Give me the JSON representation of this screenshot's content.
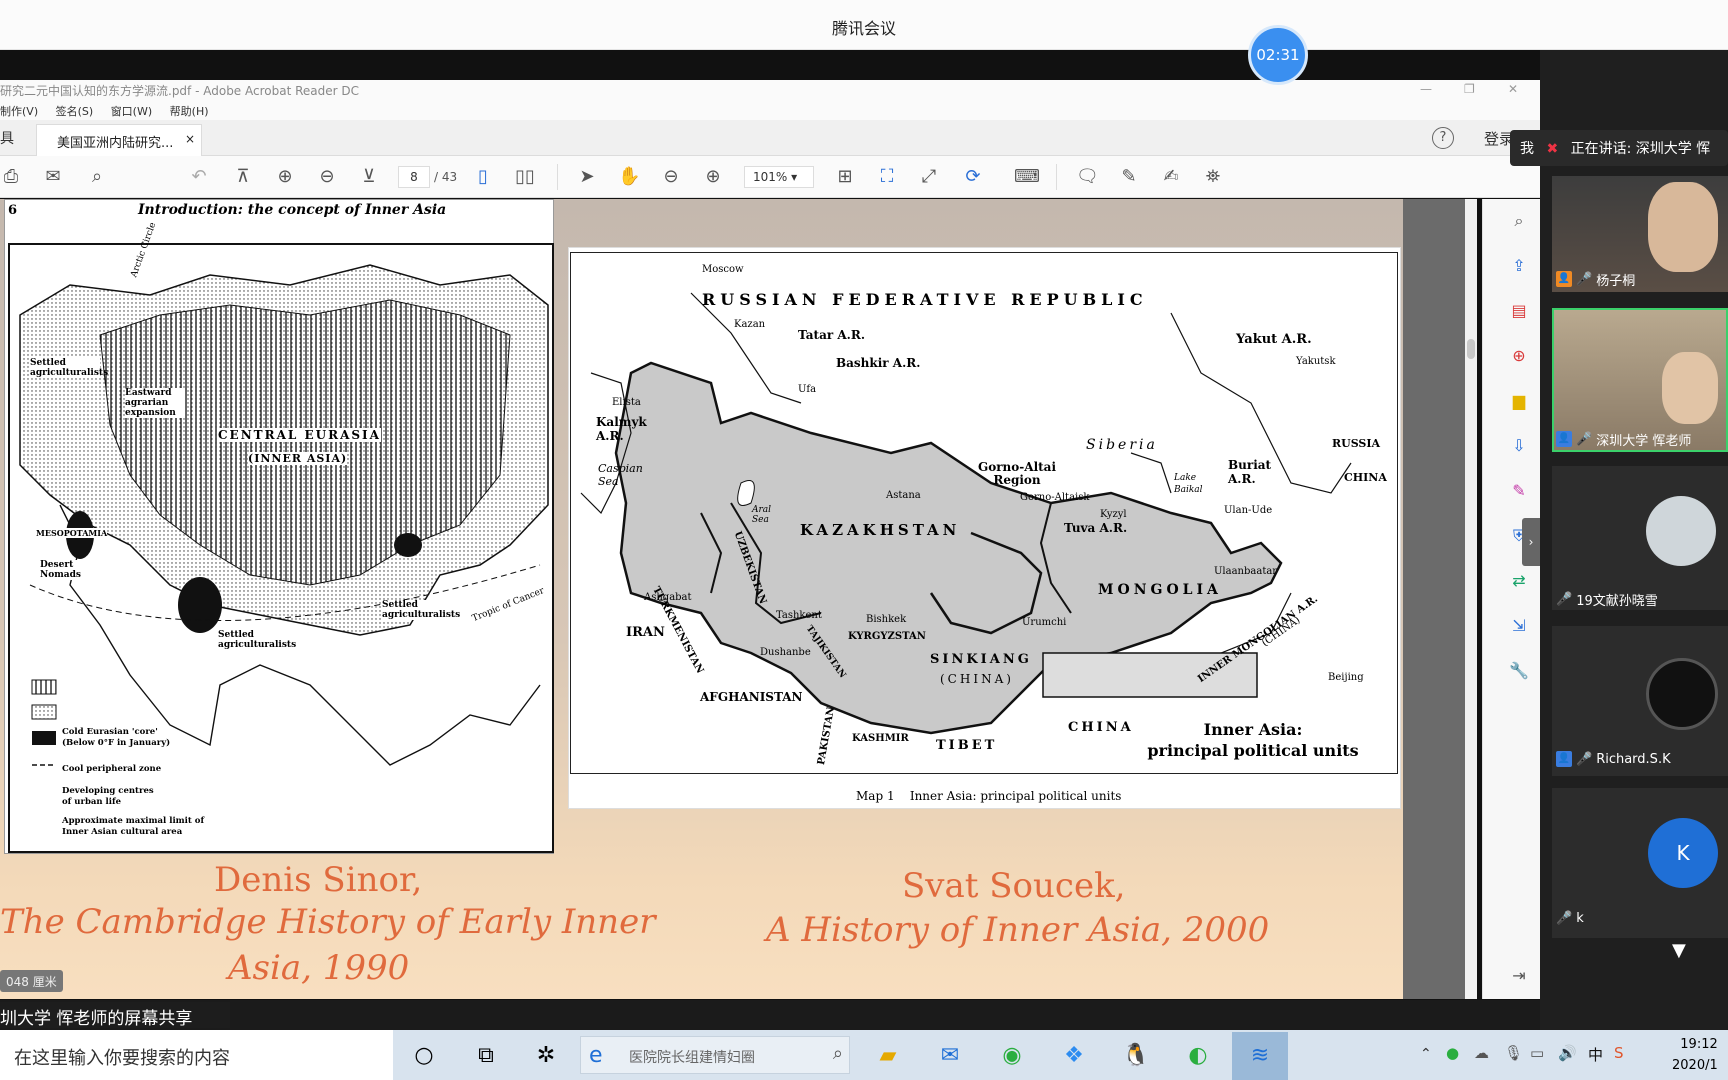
{
  "meeting": {
    "title": "腾讯会议",
    "timer": "02:31",
    "share_caption": "圳大学 恽老师的屏幕共享",
    "speaking_prefix": "我",
    "speaking_text": "正在讲话: 深圳大学 恽"
  },
  "acrobat": {
    "window_title": "研究二元中国认知的东方学源流.pdf - Adobe Acrobat Reader DC",
    "menu": [
      "制作(V)",
      "签名(S)",
      "窗口(W)",
      "帮助(H)"
    ],
    "left_label": "具",
    "tab_label": "美国亚洲内陆研究...",
    "tab_close": "×",
    "login": "登录",
    "help": "?",
    "page_current": "8",
    "page_total": "/ 43",
    "zoom": "101%",
    "size_label": "048 厘米"
  },
  "slide": {
    "left_page": {
      "page_number": "6",
      "header": "Introduction: the concept of Inner Asia",
      "map_labels": [
        "Arctic Circle",
        "Settled agriculturalists",
        "Eastward agrarian expansion",
        "CENTRAL EURASIA",
        "(INNER ASIA)",
        "MESOPOTAMIA",
        "Desert Nomads",
        "Settled agriculturalists",
        "Settled agriculturalists",
        "Tropic of Cancer"
      ],
      "legend": [
        "Cold Eurasian 'core' (Below 0°F in January)",
        "Cool peripheral zone",
        "Developing centres of urban life",
        "Approximate maximal limit of Inner Asian cultural area"
      ]
    },
    "right_page": {
      "country_labels": [
        "RUSSIAN FEDERATIVE REPUBLIC",
        "KAZAKHSTAN",
        "MONGOLIA",
        "SINKIANG",
        "(CHINA)",
        "TURKMENISTAN",
        "UZBEKISTAN",
        "KYRGYZSTAN",
        "TAJIKISTAN",
        "AFGHANISTAN",
        "IRAN",
        "PAKISTAN",
        "KASHMIR",
        "TIBET",
        "CHINA",
        "RUSSIA",
        "CHINA",
        "INNER MONGOLIAN A.R.",
        "(CHINA)"
      ],
      "region_labels": [
        "Tatar A.R.",
        "Bashkir A.R.",
        "Kalmyk A.R.",
        "Yakut A.R.",
        "Gorno-Altai Region",
        "Tuva A.R.",
        "Buriat A.R.",
        "Siberia",
        "Caspian Sea",
        "Aral Sea",
        "Lake Baikal"
      ],
      "cities": [
        "Moscow",
        "Kazan",
        "Ufa",
        "Elista",
        "Yakutsk",
        "Astana",
        "Gorno-Altaisk",
        "Kyzyl",
        "Ulan-Ude",
        "Ulaanbaatar",
        "Ashgabat",
        "Tashkent",
        "Bishkek",
        "Dushanbe",
        "Urumchi",
        "Beijing"
      ],
      "map_box_title": "Inner Asia:",
      "map_box_subtitle": "principal political units",
      "map_caption": "Map 1    Inner Asia: principal political units"
    },
    "caption_left": {
      "line1": "Denis Sinor,",
      "line2": "The Cambridge History of Early Inner",
      "line3": "Asia, 1990"
    },
    "caption_right": {
      "line1": "Svat Soucek,",
      "line2": "A History of Inner Asia, 2000"
    }
  },
  "participants": [
    {
      "name": "杨子桐",
      "type": "video"
    },
    {
      "name": "深圳大学 恽老师",
      "type": "video"
    },
    {
      "name": "19文献孙晓雪",
      "type": "avatar"
    },
    {
      "name": "Richard.S.K",
      "type": "avatar"
    },
    {
      "name": "k",
      "type": "letter",
      "letter": "K"
    }
  ],
  "taskbar": {
    "search_placeholder": "在这里输入你要搜索的内容",
    "browser_tab": "医院院长组建情妇圈",
    "ime": "中",
    "time": "19:12",
    "date": "2020/1"
  },
  "colors": {
    "accent": "#2b6fd6",
    "caption": "#e06a3d",
    "map_gray": "#c9c9c9"
  }
}
